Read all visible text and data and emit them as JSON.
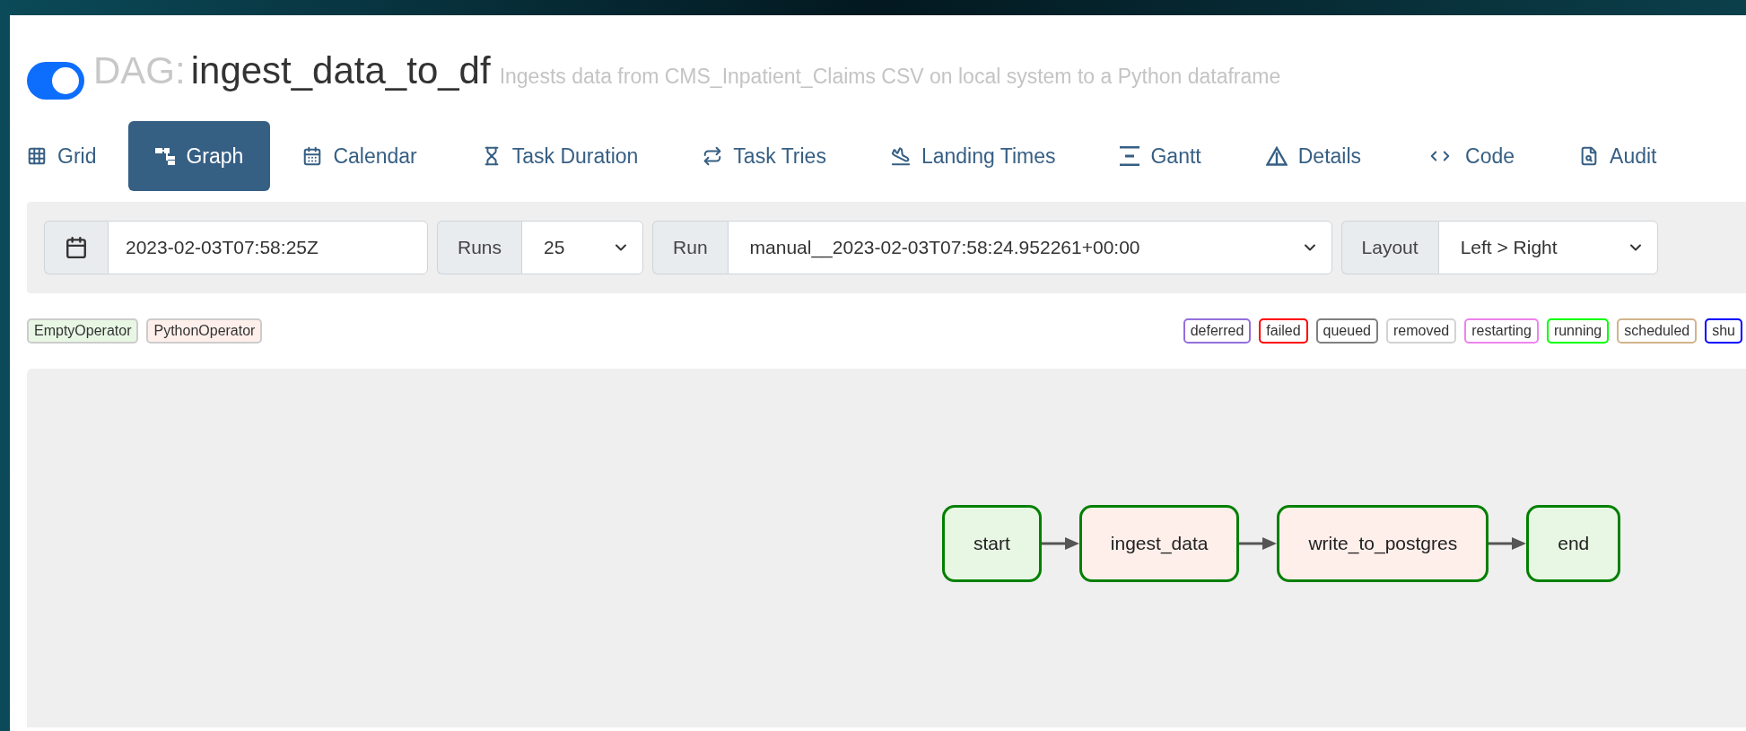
{
  "dag": {
    "toggle": {
      "on": true
    },
    "label": "DAG:",
    "name": "ingest_data_to_df",
    "description": "Ingests data from CMS_Inpatient_Claims CSV on local system to a Python dataframe"
  },
  "tabs": [
    {
      "label": "Grid",
      "selected": false
    },
    {
      "label": "Graph",
      "selected": true
    },
    {
      "label": "Calendar",
      "selected": false
    },
    {
      "label": "Task Duration",
      "selected": false
    },
    {
      "label": "Task Tries",
      "selected": false
    },
    {
      "label": "Landing Times",
      "selected": false
    },
    {
      "label": "Gantt",
      "selected": false
    },
    {
      "label": "Details",
      "selected": false
    },
    {
      "label": "Code",
      "selected": false
    },
    {
      "label": "Audit",
      "selected": false
    }
  ],
  "controls": {
    "date": "2023-02-03T07:58:25Z",
    "selects": [
      {
        "label": "Runs",
        "value": "25"
      },
      {
        "label": "Run",
        "value": "manual__2023-02-03T07:58:24.952261+00:00"
      },
      {
        "label": "Layout",
        "value": "Left > Right"
      }
    ]
  },
  "operators": [
    {
      "label": "EmptyOperator",
      "color": "#e8f7e4"
    },
    {
      "label": "PythonOperator",
      "color": "#ffefeb"
    }
  ],
  "states": [
    {
      "label": "deferred",
      "color": "#9370db"
    },
    {
      "label": "failed",
      "color": "#ff0000"
    },
    {
      "label": "queued",
      "color": "#808080"
    },
    {
      "label": "removed",
      "color": "#d3d3d3"
    },
    {
      "label": "restarting",
      "color": "#ee82ee"
    },
    {
      "label": "running",
      "color": "#00ff00"
    },
    {
      "label": "scheduled",
      "color": "#d2b48c"
    },
    {
      "label": "shu",
      "color": "#0000ff"
    }
  ],
  "graph": {
    "nodes": [
      {
        "label": "start",
        "color": "#e8f7e4",
        "succeeded": true
      },
      {
        "label": "ingest_data",
        "color": "#ffefeb",
        "succeeded": true
      },
      {
        "label": "write_to_postgres",
        "color": "#ffefeb",
        "succeeded": true
      },
      {
        "label": "end",
        "color": "#e8f7e4",
        "succeeded": true
      }
    ]
  }
}
